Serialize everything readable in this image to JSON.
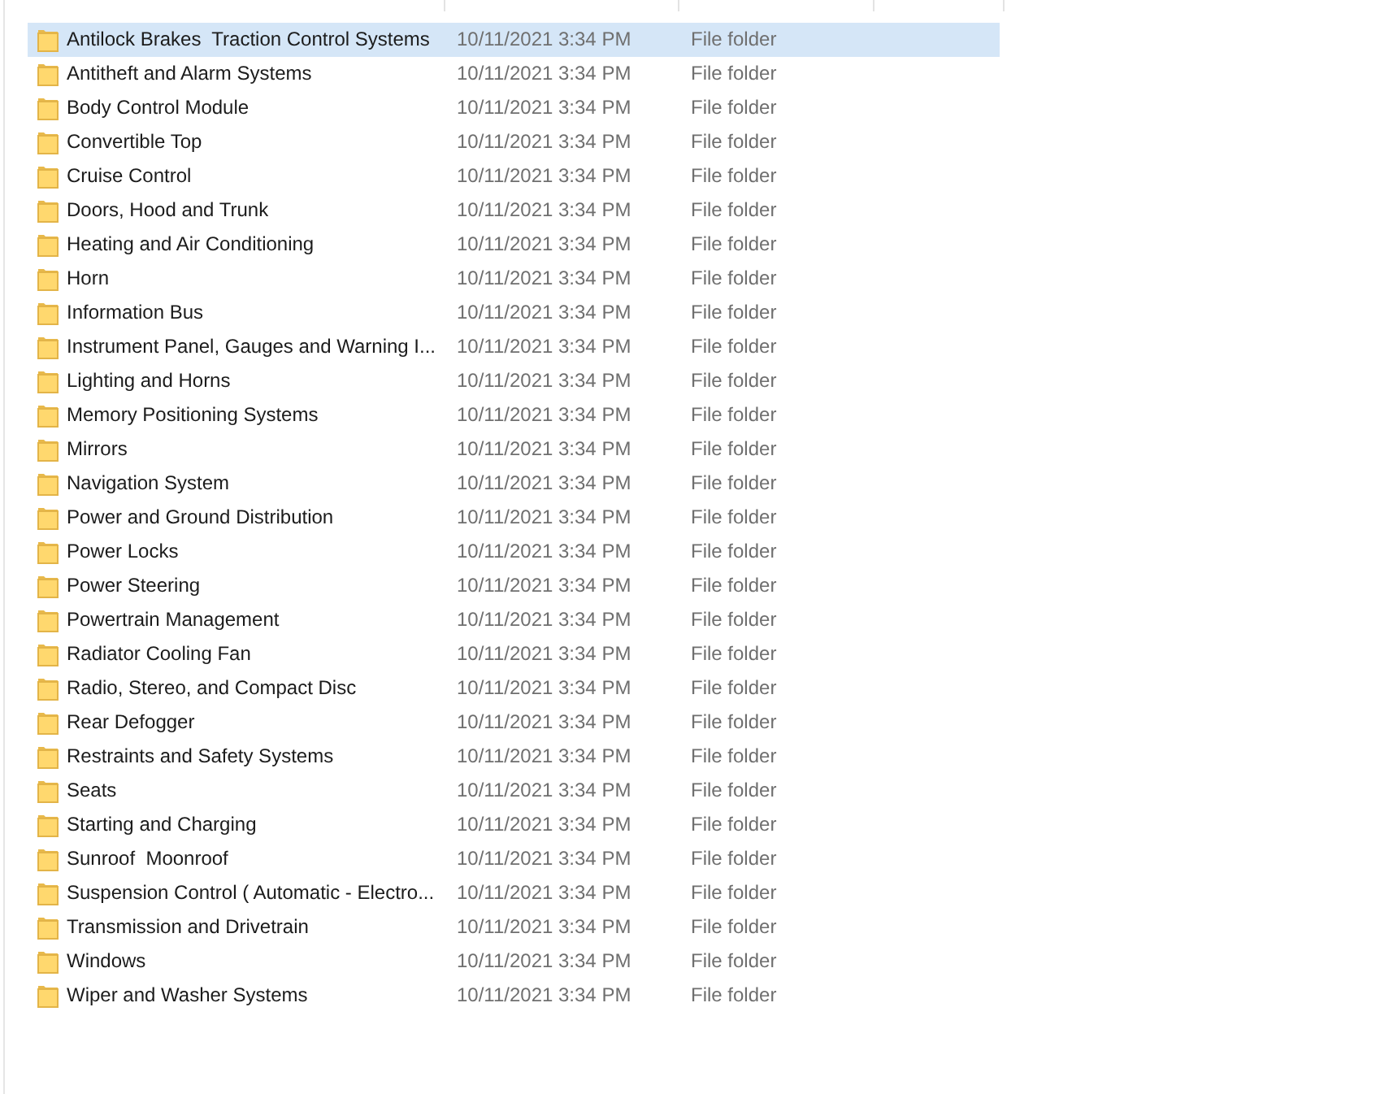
{
  "file_list": {
    "rows": [
      {
        "selected": true,
        "column_1": "Antilock Brakes  Traction Control Systems",
        "column_2": "10/11/2021 3:34 PM",
        "column_3": "File folder"
      },
      {
        "selected": false,
        "column_1": "Antitheft and Alarm Systems",
        "column_2": "10/11/2021 3:34 PM",
        "column_3": "File folder"
      },
      {
        "selected": false,
        "column_1": "Body Control Module",
        "column_2": "10/11/2021 3:34 PM",
        "column_3": "File folder"
      },
      {
        "selected": false,
        "column_1": "Convertible Top",
        "column_2": "10/11/2021 3:34 PM",
        "column_3": "File folder"
      },
      {
        "selected": false,
        "column_1": "Cruise Control",
        "column_2": "10/11/2021 3:34 PM",
        "column_3": "File folder"
      },
      {
        "selected": false,
        "column_1": "Doors, Hood and Trunk",
        "column_2": "10/11/2021 3:34 PM",
        "column_3": "File folder"
      },
      {
        "selected": false,
        "column_1": "Heating and Air Conditioning",
        "column_2": "10/11/2021 3:34 PM",
        "column_3": "File folder"
      },
      {
        "selected": false,
        "column_1": "Horn",
        "column_2": "10/11/2021 3:34 PM",
        "column_3": "File folder"
      },
      {
        "selected": false,
        "column_1": "Information Bus",
        "column_2": "10/11/2021 3:34 PM",
        "column_3": "File folder"
      },
      {
        "selected": false,
        "column_1": "Instrument Panel, Gauges and Warning I...",
        "column_2": "10/11/2021 3:34 PM",
        "column_3": "File folder"
      },
      {
        "selected": false,
        "column_1": "Lighting and Horns",
        "column_2": "10/11/2021 3:34 PM",
        "column_3": "File folder"
      },
      {
        "selected": false,
        "column_1": "Memory Positioning Systems",
        "column_2": "10/11/2021 3:34 PM",
        "column_3": "File folder"
      },
      {
        "selected": false,
        "column_1": "Mirrors",
        "column_2": "10/11/2021 3:34 PM",
        "column_3": "File folder"
      },
      {
        "selected": false,
        "column_1": "Navigation System",
        "column_2": "10/11/2021 3:34 PM",
        "column_3": "File folder"
      },
      {
        "selected": false,
        "column_1": "Power and Ground Distribution",
        "column_2": "10/11/2021 3:34 PM",
        "column_3": "File folder"
      },
      {
        "selected": false,
        "column_1": "Power Locks",
        "column_2": "10/11/2021 3:34 PM",
        "column_3": "File folder"
      },
      {
        "selected": false,
        "column_1": "Power Steering",
        "column_2": "10/11/2021 3:34 PM",
        "column_3": "File folder"
      },
      {
        "selected": false,
        "column_1": "Powertrain Management",
        "column_2": "10/11/2021 3:34 PM",
        "column_3": "File folder"
      },
      {
        "selected": false,
        "column_1": "Radiator Cooling Fan",
        "column_2": "10/11/2021 3:34 PM",
        "column_3": "File folder"
      },
      {
        "selected": false,
        "column_1": "Radio, Stereo, and Compact Disc",
        "column_2": "10/11/2021 3:34 PM",
        "column_3": "File folder"
      },
      {
        "selected": false,
        "column_1": "Rear Defogger",
        "column_2": "10/11/2021 3:34 PM",
        "column_3": "File folder"
      },
      {
        "selected": false,
        "column_1": "Restraints and Safety Systems",
        "column_2": "10/11/2021 3:34 PM",
        "column_3": "File folder"
      },
      {
        "selected": false,
        "column_1": "Seats",
        "column_2": "10/11/2021 3:34 PM",
        "column_3": "File folder"
      },
      {
        "selected": false,
        "column_1": "Starting and Charging",
        "column_2": "10/11/2021 3:34 PM",
        "column_3": "File folder"
      },
      {
        "selected": false,
        "column_1": "Sunroof  Moonroof",
        "column_2": "10/11/2021 3:34 PM",
        "column_3": "File folder"
      },
      {
        "selected": false,
        "column_1": "Suspension Control ( Automatic - Electro...",
        "column_2": "10/11/2021 3:34 PM",
        "column_3": "File folder"
      },
      {
        "selected": false,
        "column_1": "Transmission and Drivetrain",
        "column_2": "10/11/2021 3:34 PM",
        "column_3": "File folder"
      },
      {
        "selected": false,
        "column_1": "Windows",
        "column_2": "10/11/2021 3:34 PM",
        "column_3": "File folder"
      },
      {
        "selected": false,
        "column_1": "Wiper and Washer Systems",
        "column_2": "10/11/2021 3:34 PM",
        "column_3": "File folder"
      }
    ]
  }
}
